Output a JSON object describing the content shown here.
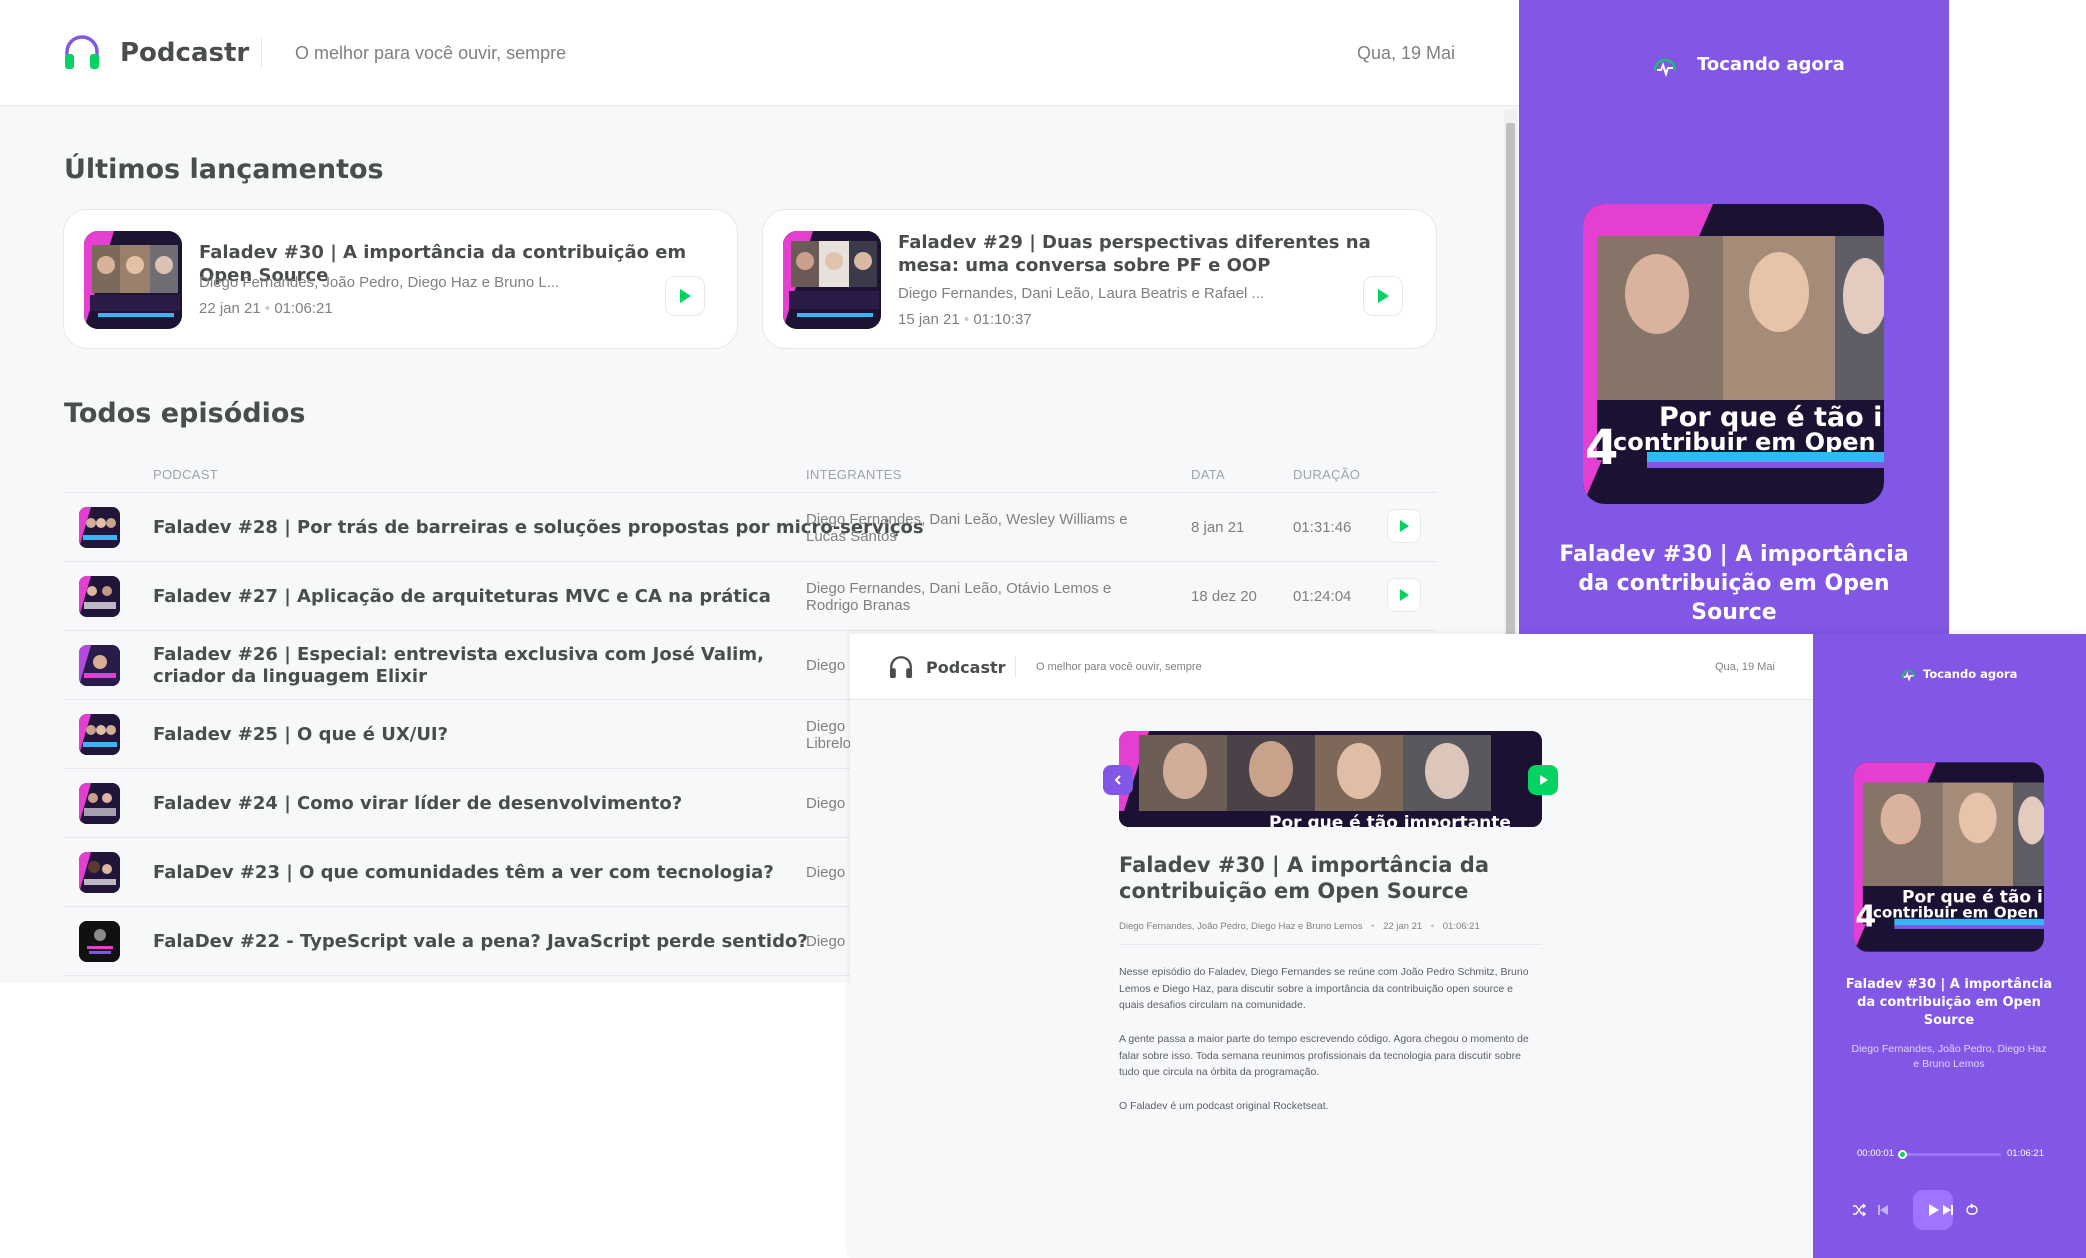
{
  "colors": {
    "accent": "#8257e5",
    "accent_light": "#9f75ff",
    "green": "#04d361",
    "text": "#494d4b",
    "muted": "#808080",
    "bg": "#f7f8fa",
    "border": "#e6e8eb"
  },
  "icons": {
    "logo": "headphones-icon",
    "play": "play-icon",
    "now_playing": "playing-wave-icon",
    "back": "chevron-left-icon",
    "shuffle": "shuffle-icon",
    "prev": "skip-back-icon",
    "next": "skip-forward-icon",
    "repeat": "repeat-icon"
  },
  "home": {
    "header": {
      "app_name": "Podcastr",
      "tagline": "O melhor para você ouvir, sempre",
      "date": "Qua, 19 Mai"
    },
    "latest": {
      "title": "Últimos lançamentos",
      "items": [
        {
          "title": "Faladev #30 | A importância da contribuição em Open Source",
          "members": "Diego Fernandes, João Pedro, Diego Haz e Bruno L...",
          "date": "22 jan 21",
          "duration": "01:06:21"
        },
        {
          "title": "Faladev #29 | Duas perspectivas diferentes na mesa: uma conversa sobre PF e OOP",
          "members": "Diego Fernandes, Dani Leão, Laura Beatris e Rafael ...",
          "date": "15 jan 21",
          "duration": "01:10:37"
        }
      ]
    },
    "all": {
      "title": "Todos episódios",
      "columns": {
        "podcast": "PODCAST",
        "members": "INTEGRANTES",
        "date": "DATA",
        "duration": "DURAÇÃO"
      },
      "rows": [
        {
          "title": "Faladev #28 | Por trás de barreiras e soluções propostas por micro-serviços",
          "members": "Diego Fernandes, Dani Leão, Wesley Williams e Lucas Santos",
          "date": "8 jan 21",
          "duration": "01:31:46"
        },
        {
          "title": "Faladev #27 | Aplicação de arquiteturas MVC e CA na prática",
          "members": "Diego Fernandes, Dani Leão, Otávio Lemos e Rodrigo Branas",
          "date": "18 dez 20",
          "duration": "01:24:04"
        },
        {
          "title": "Faladev #26 | Especial: entrevista exclusiva com José Valim, criador da linguagem Elixir",
          "members": "Diego",
          "date": "",
          "duration": ""
        },
        {
          "title": "Faladev #25 | O que é UX/UI?",
          "members": "Diego Librelo",
          "date": "",
          "duration": ""
        },
        {
          "title": "Faladev #24 | Como virar líder de desenvolvimento?",
          "members": "Diego",
          "date": "",
          "duration": ""
        },
        {
          "title": "FalaDev #23 | O que comunidades têm a ver com tecnologia?",
          "members": "Diego",
          "date": "",
          "duration": ""
        },
        {
          "title": "FalaDev #22 - TypeScript vale a pena? JavaScript perde sentido?",
          "members": "Diego",
          "date": "",
          "duration": ""
        }
      ]
    },
    "player": {
      "label": "Tocando agora",
      "cover_text": "Por que é tão imp contribuir em Open S",
      "title": "Faladev #30 | A importância da contribuição em Open Source"
    }
  },
  "episode": {
    "header": {
      "app_name": "Podcastr",
      "tagline": "O melhor para você ouvir, sempre",
      "date": "Qua, 19 Mai"
    },
    "banner_text": "Por que é tão importante",
    "title": "Faladev #30 | A importância da contribuição em Open Source",
    "members": "Diego Fernandes, João Pedro, Diego Haz e Bruno Lemos",
    "date": "22 jan 21",
    "duration": "01:06:21",
    "description": [
      "Nesse episódio do Faladev, Diego Fernandes se reúne com João Pedro Schmitz, Bruno Lemos e Diego Haz, para discutir sobre a importância da contribuição open source e quais desafios circulam na comunidade.",
      "A gente passa a maior parte do tempo escrevendo código. Agora chegou o momento de falar sobre isso. Toda semana reunimos profissionais da tecnologia para discutir sobre tudo que circula na órbita da programação.",
      "O Faladev é um podcast original Rocketseat."
    ],
    "player": {
      "label": "Tocando agora",
      "cover_text": "Por que é tão imp contribuir em Open S",
      "title": "Faladev #30 | A importância da contribuição em Open Source",
      "members": "Diego Fernandes, João Pedro, Diego Haz e Bruno Lemos",
      "current_time": "00:00:01",
      "total_time": "01:06:21",
      "progress": 0.02
    }
  }
}
